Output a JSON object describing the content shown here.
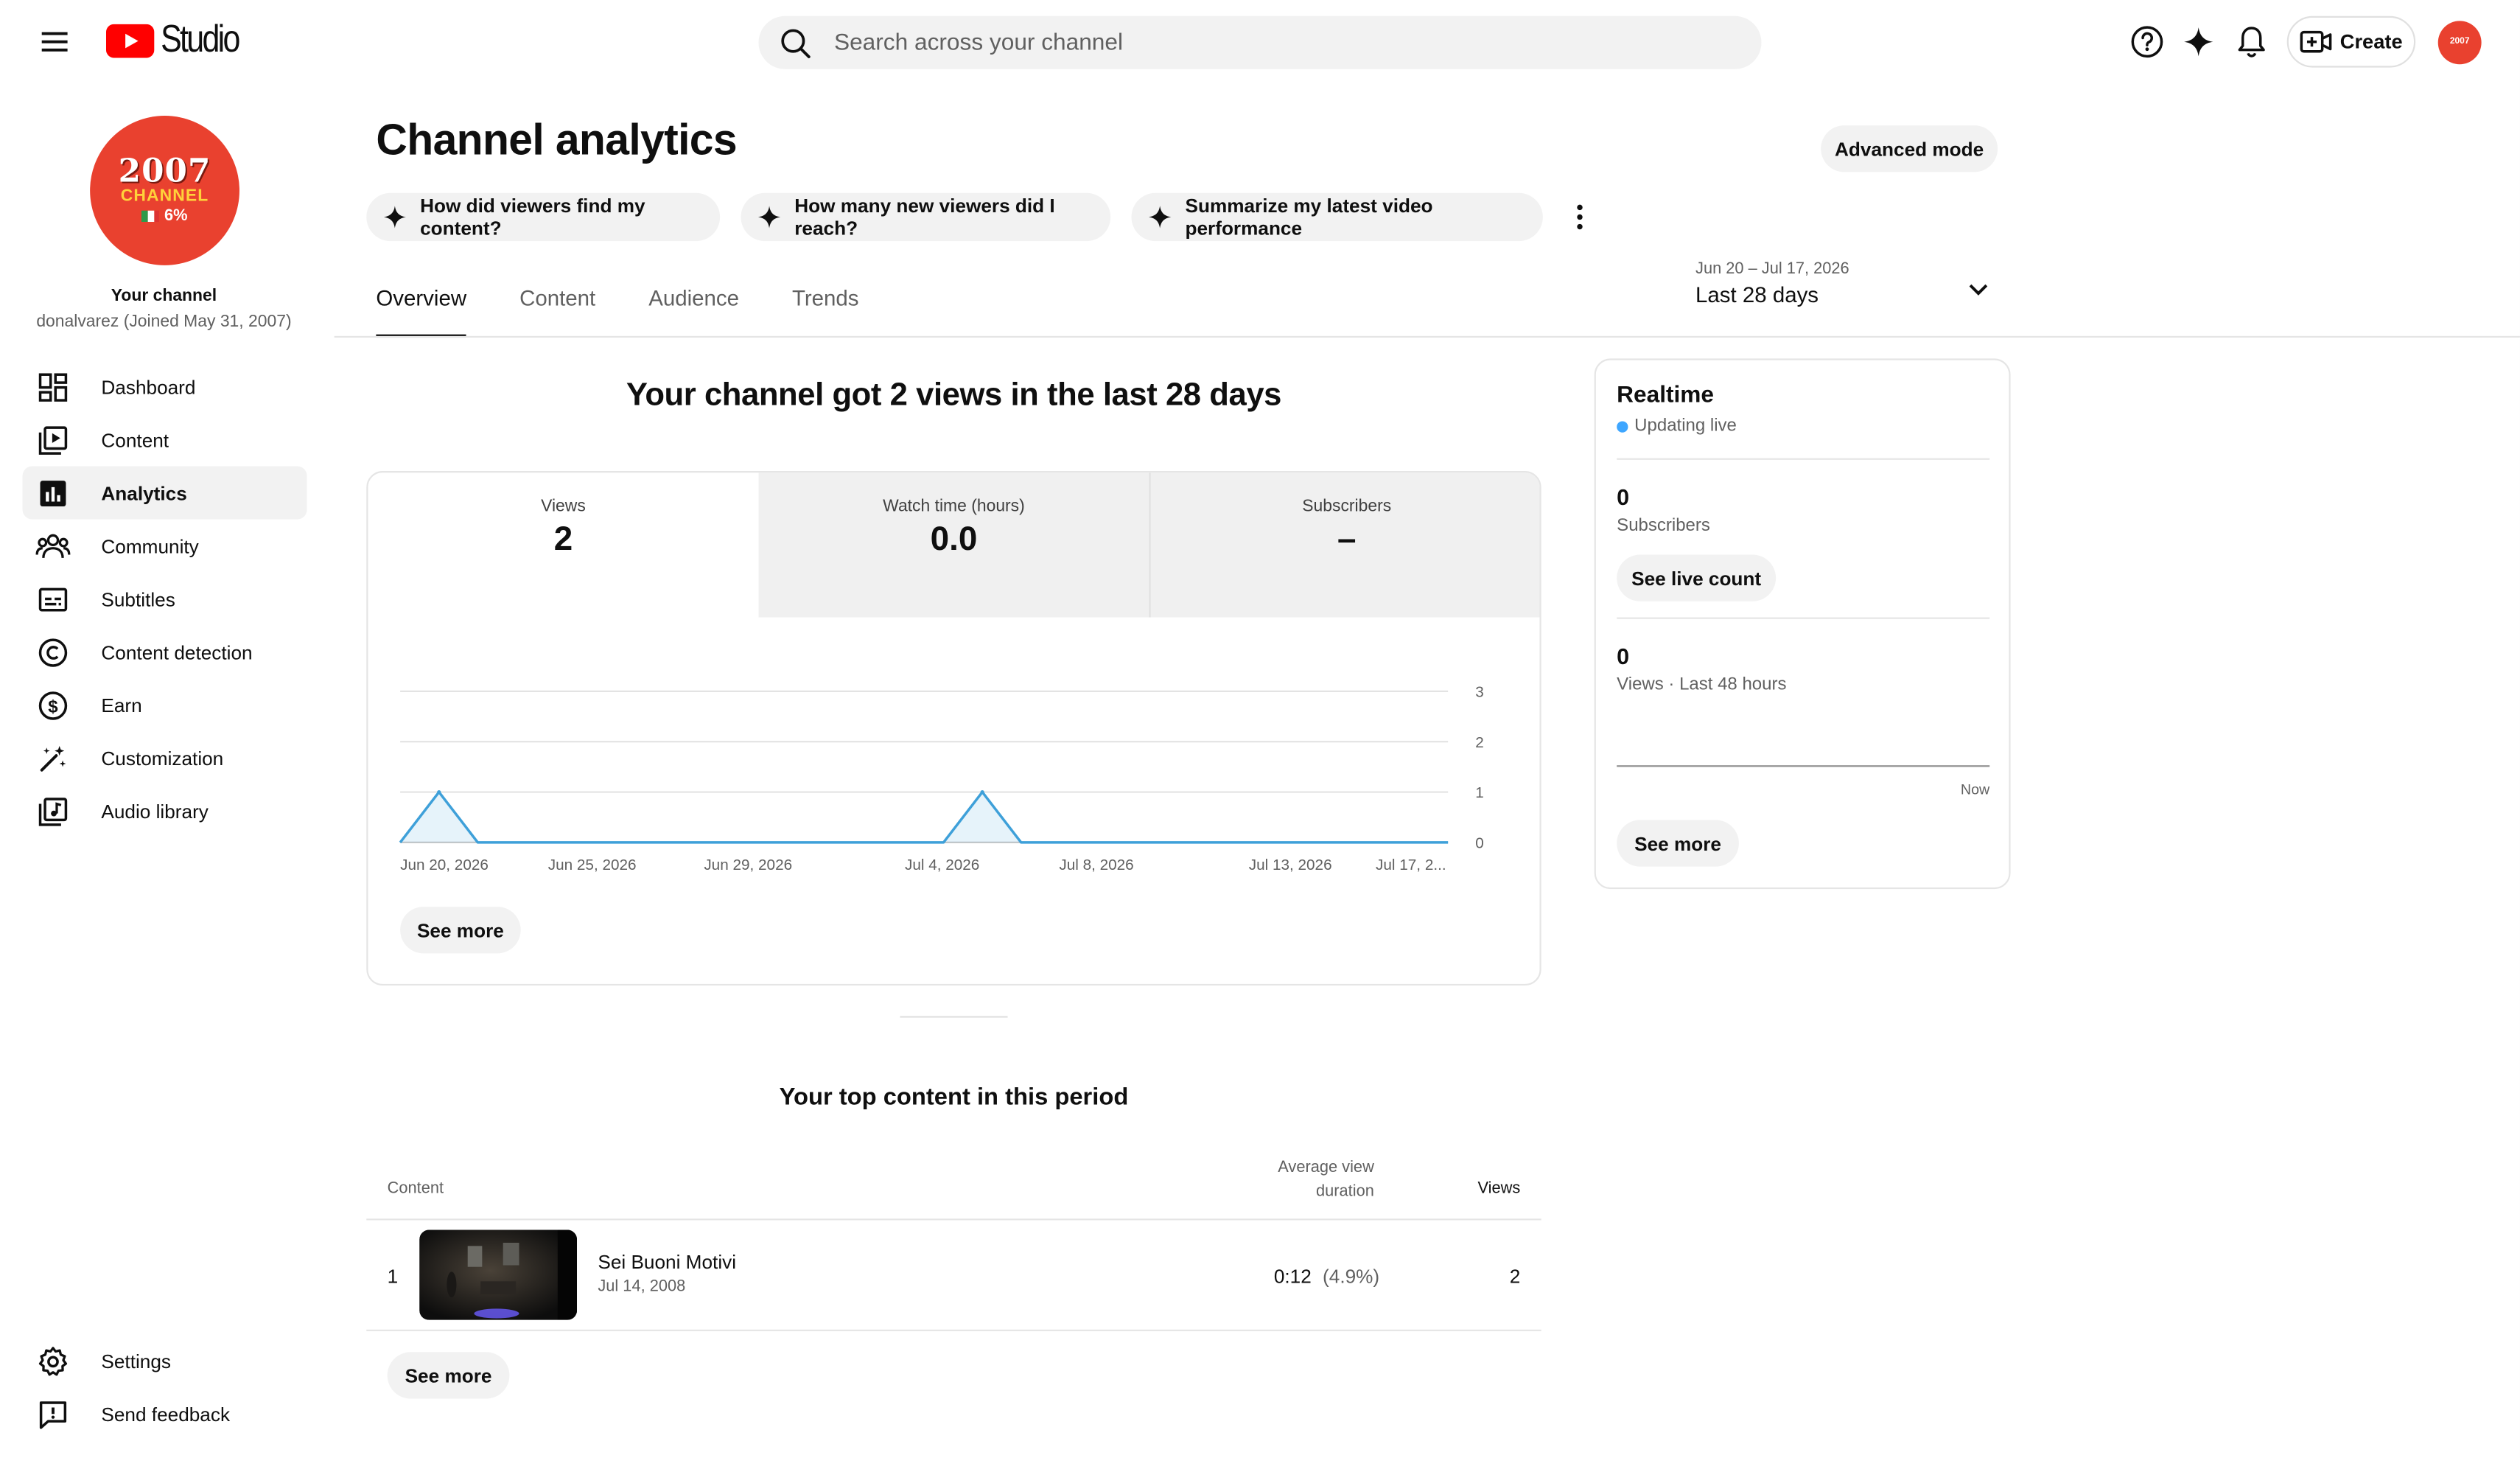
{
  "header": {
    "logo_text": "Studio",
    "search_placeholder": "Search across your channel",
    "create_label": "Create",
    "avatar_text": "2007"
  },
  "channel": {
    "avatar_line1": "2007",
    "avatar_line2": "CHANNEL",
    "avatar_line3": "6%",
    "label": "Your channel",
    "meta": "donalvarez (Joined May 31, 2007)"
  },
  "sidebar": {
    "items": [
      {
        "label": "Dashboard",
        "icon": "dashboard-icon"
      },
      {
        "label": "Content",
        "icon": "content-icon"
      },
      {
        "label": "Analytics",
        "icon": "analytics-icon",
        "active": true
      },
      {
        "label": "Community",
        "icon": "community-icon"
      },
      {
        "label": "Subtitles",
        "icon": "subtitles-icon"
      },
      {
        "label": "Content detection",
        "icon": "copyright-icon"
      },
      {
        "label": "Earn",
        "icon": "dollar-icon"
      },
      {
        "label": "Customization",
        "icon": "magic-wand-icon"
      },
      {
        "label": "Audio library",
        "icon": "audio-library-icon"
      }
    ],
    "bottom_items": [
      {
        "label": "Settings",
        "icon": "gear-icon"
      },
      {
        "label": "Send feedback",
        "icon": "feedback-icon"
      }
    ]
  },
  "page": {
    "title": "Channel analytics",
    "advanced_mode_label": "Advanced mode",
    "chips": [
      "How did viewers find my content?",
      "How many new viewers did I reach?",
      "Summarize my latest video performance"
    ],
    "tabs": [
      "Overview",
      "Content",
      "Audience",
      "Trends"
    ],
    "active_tab": "Overview",
    "date_range": "Jun 20 – Jul 17, 2026",
    "date_label": "Last 28 days"
  },
  "overview": {
    "headline": "Your channel got 2 views in the last 28 days",
    "metrics": [
      {
        "label": "Views",
        "value": "2",
        "selected": true
      },
      {
        "label": "Watch time (hours)",
        "value": "0.0",
        "selected": false
      },
      {
        "label": "Subscribers",
        "value": "–",
        "selected": false
      }
    ],
    "see_more_label": "See more"
  },
  "chart_data": {
    "type": "area",
    "title": "",
    "xlabel": "",
    "ylabel": "",
    "ylim": [
      0,
      3
    ],
    "yticks": [
      "0",
      "1",
      "2",
      "3"
    ],
    "x_tick_labels": [
      "Jun 20, 2026",
      "Jun 25, 2026",
      "Jun 29, 2026",
      "Jul 4, 2026",
      "Jul 8, 2026",
      "Jul 13, 2026",
      "Jul 17, 2..."
    ],
    "x": [
      "Jun 20",
      "Jun 21",
      "Jun 22",
      "Jun 23",
      "Jun 24",
      "Jun 25",
      "Jun 26",
      "Jun 27",
      "Jun 28",
      "Jun 29",
      "Jun 30",
      "Jul 1",
      "Jul 2",
      "Jul 3",
      "Jul 4",
      "Jul 5",
      "Jul 6",
      "Jul 7",
      "Jul 8",
      "Jul 9",
      "Jul 10",
      "Jul 11",
      "Jul 12",
      "Jul 13",
      "Jul 14",
      "Jul 15",
      "Jul 16",
      "Jul 17"
    ],
    "series": [
      {
        "values": [
          0,
          1,
          0,
          0,
          0,
          0,
          0,
          0,
          0,
          0,
          0,
          0,
          0,
          0,
          0,
          1,
          0,
          0,
          0,
          0,
          0,
          0,
          0,
          0,
          0,
          0,
          0,
          0
        ]
      }
    ],
    "grid": true,
    "color": "#3ea0d9"
  },
  "top_content": {
    "title": "Your top content in this period",
    "col_content": "Content",
    "col_avd": "Average view duration",
    "col_views": "Views",
    "rows": [
      {
        "rank": "1",
        "title": "Sei Buoni Motivi",
        "date": "Jul 14, 2008",
        "avd": "0:12",
        "avd_pct": "(4.9%)",
        "views": "2"
      }
    ],
    "see_more_label": "See more"
  },
  "realtime": {
    "title": "Realtime",
    "live_label": "Updating live",
    "subscribers_value": "0",
    "subscribers_label": "Subscribers",
    "see_live_count_label": "See live count",
    "views_value": "0",
    "views_label": "Views · Last 48 hours",
    "now_label": "Now",
    "see_more_label": "See more"
  },
  "colors": {
    "brand_red": "#ff0000",
    "accent_blue": "#3ea6ff",
    "chart_line": "#3ea0d9",
    "channel_avatar_bg": "#e9412f"
  }
}
